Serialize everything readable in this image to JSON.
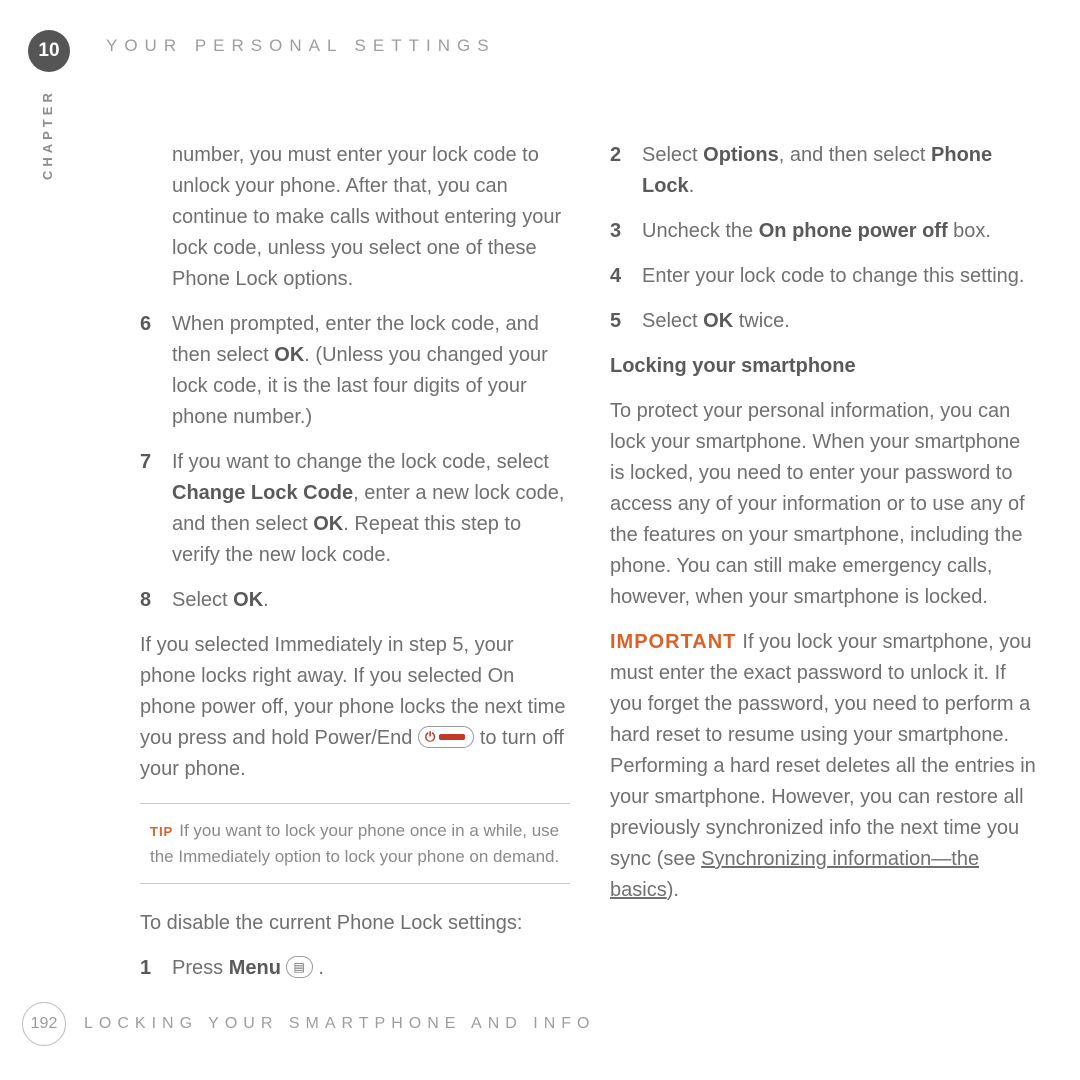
{
  "chapter": {
    "number": "10",
    "side_label": "CHAPTER",
    "header": "YOUR PERSONAL SETTINGS"
  },
  "left": {
    "intro": "number, you must enter your lock code to unlock your phone. After that, you can continue to make calls without entering your lock code, unless you select one of these Phone Lock options.",
    "steps": [
      {
        "n": "6",
        "pre": "When prompted, enter the lock code, and then select ",
        "b1": "OK",
        "post": ". (Unless you changed your lock code, it is the last four digits of your phone number.)"
      },
      {
        "n": "7",
        "pre": "If you want to change the lock code, select ",
        "b1": "Change Lock Code",
        "mid": ", enter a new lock code, and then select ",
        "b2": "OK",
        "post": ". Repeat this step to verify the new lock code."
      },
      {
        "n": "8",
        "pre": "Select ",
        "b1": "OK",
        "post": "."
      }
    ],
    "after_steps_pre": "If you selected Immediately in step 5, your phone locks right away. If you selected On phone power off, your phone locks the next time you press and hold Power/End ",
    "after_steps_post": " to turn off your phone.",
    "tip": {
      "label": "TIP",
      "text": "If you want to lock your phone once in a while, use the Immediately option to lock your phone on demand."
    },
    "disable_intro": "To  disable the current Phone Lock settings:",
    "menu_step": {
      "n": "1",
      "pre": "Press ",
      "b1": "Menu",
      "post": " ."
    }
  },
  "right": {
    "steps": [
      {
        "n": "2",
        "pre": "Select ",
        "b1": "Options",
        "mid": ", and then select ",
        "b2": "Phone Lock",
        "post": "."
      },
      {
        "n": "3",
        "pre": "Uncheck the ",
        "b1": "On phone power off",
        "post": " box."
      },
      {
        "n": "4",
        "pre": "Enter your lock code to change this setting."
      },
      {
        "n": "5",
        "pre": "Select ",
        "b1": "OK",
        "post": " twice."
      }
    ],
    "h2": "Locking your smartphone",
    "para1": "To protect your personal information, you can lock your smartphone. When your smartphone is locked, you need to enter your password to access any of your information or to use any of the features on your smartphone, including the phone. You can still make emergency calls, however, when your smartphone is locked.",
    "important_label": "IMPORTANT",
    "important_pre": "If you lock your smartphone, you must enter the exact password to unlock it. If you forget the password, you need to perform a hard reset to resume using your smartphone. Performing a hard reset deletes all the entries in your smartphone. However, you can restore all previously synchronized info the next time you sync (see ",
    "important_link": "Synchronizing information—the basics",
    "important_post": ")."
  },
  "footer": {
    "page": "192",
    "title": "LOCKING YOUR SMARTPHONE AND INFO"
  }
}
